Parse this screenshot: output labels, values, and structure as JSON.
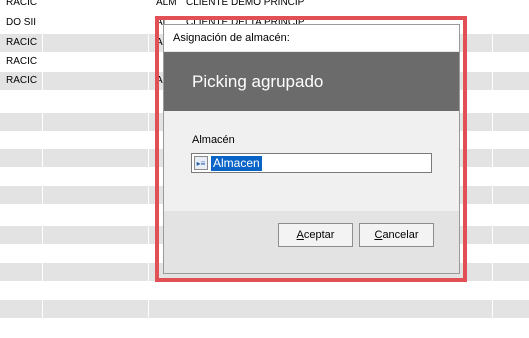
{
  "background_table": {
    "rows": [
      {
        "c1": "RACIC",
        "c2": "ALM",
        "c3": "CLIENTE DEMO PRINCIP"
      },
      {
        "c1": "DO SII",
        "c2": "AL",
        "c3": "CLIENTE DELTA PRINCIP"
      },
      {
        "c1": "RACIĆ",
        "c2": "A",
        "c3": ""
      },
      {
        "c1": "RACIĆ",
        "c2": "",
        "c3": ""
      },
      {
        "c1": "RACIĆ",
        "c2": "A",
        "c3": ""
      }
    ]
  },
  "dialog": {
    "title": "Asignación de almacén:",
    "header": "Picking agrupado",
    "field_label": "Almacén",
    "field_value": "Almacen",
    "lookup_icon": "lookup-icon",
    "accept_label_hotkey": "A",
    "accept_label_rest": "ceptar",
    "cancel_label_hotkey": "C",
    "cancel_label_rest": "ancelar"
  },
  "colors": {
    "highlight_frame": "#e05054",
    "header_bg": "#6b6b6b",
    "selection": "#0a64c8"
  }
}
